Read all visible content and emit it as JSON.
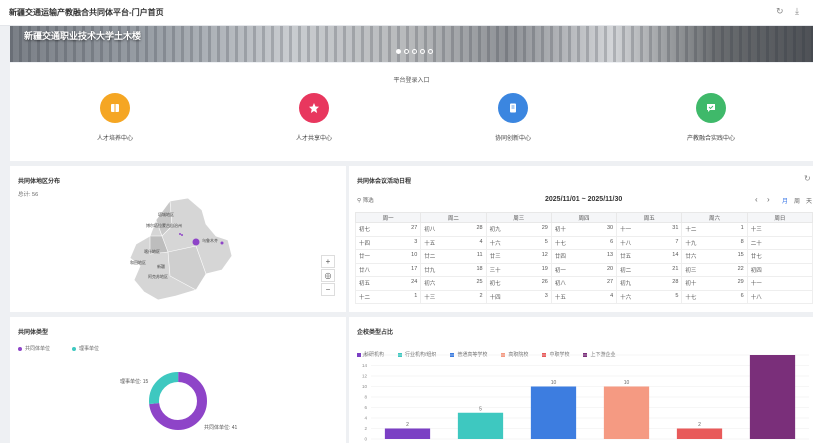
{
  "window": {
    "title": "新疆交通运输产教融合共同体平台-门户首页"
  },
  "banner": {
    "caption": "新疆交通职业技术大学土木楼"
  },
  "entry": {
    "header": "平台登录入口",
    "items": [
      {
        "label": "人才培养中心",
        "color": "#f5a623",
        "icon": "book-icon"
      },
      {
        "label": "人才共享中心",
        "color": "#e8375e",
        "icon": "star-icon"
      },
      {
        "label": "协同创新中心",
        "color": "#3b86e0",
        "icon": "document-icon"
      },
      {
        "label": "产教融合实践中心",
        "color": "#3fb96a",
        "icon": "chat-icon"
      }
    ]
  },
  "map_panel": {
    "title": "共同体地区分布",
    "total": "总计: 56",
    "labels": [
      "塔城地区",
      "博尔塔拉蒙古自治州",
      "乌鲁木齐",
      "喀什地区",
      "和田地区",
      "新疆",
      "阿克苏地区"
    ]
  },
  "calendar": {
    "title": "共同体会议活动日程",
    "filter": "筛选",
    "range": "2025/11/01 ~ 2025/11/30",
    "view_options": [
      "月",
      "周",
      "天"
    ],
    "weekdays": [
      "周一",
      "周二",
      "周三",
      "周四",
      "周五",
      "周六",
      "周日"
    ],
    "rows": [
      [
        [
          "初七",
          "27"
        ],
        [
          "初八",
          "28"
        ],
        [
          "初九",
          "29"
        ],
        [
          "初十",
          "30"
        ],
        [
          "十一",
          "31"
        ],
        [
          "十二",
          "1"
        ],
        [
          "十三",
          ""
        ]
      ],
      [
        [
          "十四",
          "3"
        ],
        [
          "十五",
          "4"
        ],
        [
          "十六",
          "5"
        ],
        [
          "十七",
          "6"
        ],
        [
          "十八",
          "7"
        ],
        [
          "十九",
          "8"
        ],
        [
          "二十",
          ""
        ]
      ],
      [
        [
          "廿一",
          "10"
        ],
        [
          "廿二",
          "11"
        ],
        [
          "廿三",
          "12"
        ],
        [
          "廿四",
          "13"
        ],
        [
          "廿五",
          "14"
        ],
        [
          "廿六",
          "15"
        ],
        [
          "廿七",
          ""
        ]
      ],
      [
        [
          "廿八",
          "17"
        ],
        [
          "廿九",
          "18"
        ],
        [
          "三十",
          "19"
        ],
        [
          "初一",
          "20"
        ],
        [
          "初二",
          "21"
        ],
        [
          "初三",
          "22"
        ],
        [
          "初四",
          ""
        ]
      ],
      [
        [
          "初五",
          "24"
        ],
        [
          "初六",
          "25"
        ],
        [
          "初七",
          "26"
        ],
        [
          "初八",
          "27"
        ],
        [
          "初九",
          "28"
        ],
        [
          "初十",
          "29"
        ],
        [
          "十一",
          ""
        ]
      ],
      [
        [
          "十二",
          "1"
        ],
        [
          "十三",
          "2"
        ],
        [
          "十四",
          "3"
        ],
        [
          "十五",
          "4"
        ],
        [
          "十六",
          "5"
        ],
        [
          "十七",
          "6"
        ],
        [
          "十八",
          ""
        ]
      ]
    ],
    "today_label": "19"
  },
  "type_panel": {
    "title": "共同体类型",
    "legend": [
      {
        "name": "共同体单位",
        "color": "#8e44c8"
      },
      {
        "name": "理事单位",
        "color": "#3ec8c0"
      }
    ],
    "slices": [
      {
        "name": "共同体单位",
        "value": 41,
        "label": "共同体单位: 41"
      },
      {
        "name": "理事单位",
        "value": 15,
        "label": "理事单位: 15"
      }
    ]
  },
  "ent_panel": {
    "title": "企校类型占比"
  },
  "chart_data": {
    "type": "bar",
    "categories": [
      "科研机构",
      "行业机构/组织",
      "普通高等学校",
      "高职院校",
      "中职学校",
      "上下游企业"
    ],
    "values": [
      2,
      5,
      10,
      10,
      2,
      16
    ],
    "colors": [
      "#7b3fc4",
      "#3ec8c0",
      "#3d7de0",
      "#f59a82",
      "#e85a5a",
      "#7a2f7a"
    ],
    "yticks": [
      "0",
      "2",
      "4",
      "6",
      "8",
      "10",
      "12",
      "14",
      "16"
    ],
    "ylim": [
      0,
      16
    ],
    "data_labels": [
      "2",
      "5",
      "10",
      "10",
      "2",
      "16"
    ]
  }
}
